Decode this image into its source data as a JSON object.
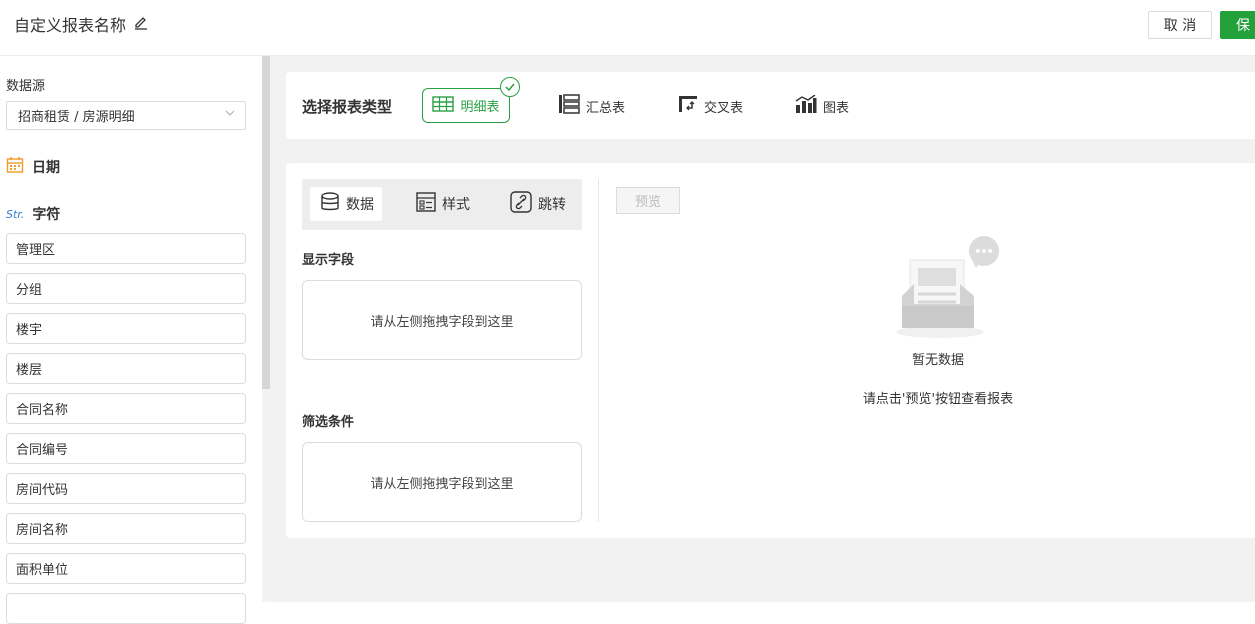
{
  "header": {
    "report_name": "自定义报表名称",
    "cancel_label": "取 消",
    "save_label": "保"
  },
  "sidebar": {
    "datasource_label": "数据源",
    "datasource_value": "招商租赁 / 房源明细",
    "date_group": "日期",
    "string_group": "字符",
    "string_tag": "Str.",
    "fields": [
      "管理区",
      "分组",
      "楼宇",
      "楼层",
      "合同名称",
      "合同编号",
      "房间代码",
      "房间名称",
      "面积单位"
    ]
  },
  "report_type": {
    "title": "选择报表类型",
    "options": [
      "明细表",
      "汇总表",
      "交叉表",
      "图表"
    ],
    "selected": "明细表"
  },
  "config": {
    "tabs": [
      "数据",
      "样式",
      "跳转"
    ],
    "display_fields_label": "显示字段",
    "display_fields_placeholder": "请从左侧拖拽字段到这里",
    "filter_label": "筛选条件",
    "filter_placeholder": "请从左侧拖拽字段到这里"
  },
  "preview": {
    "button_label": "预览",
    "empty_title": "暂无数据",
    "empty_hint": "请点击'预览'按钮查看报表"
  },
  "colors": {
    "accent": "#2aa044",
    "save_bg": "#22a03a",
    "page_bg": "#f2f2f2"
  }
}
